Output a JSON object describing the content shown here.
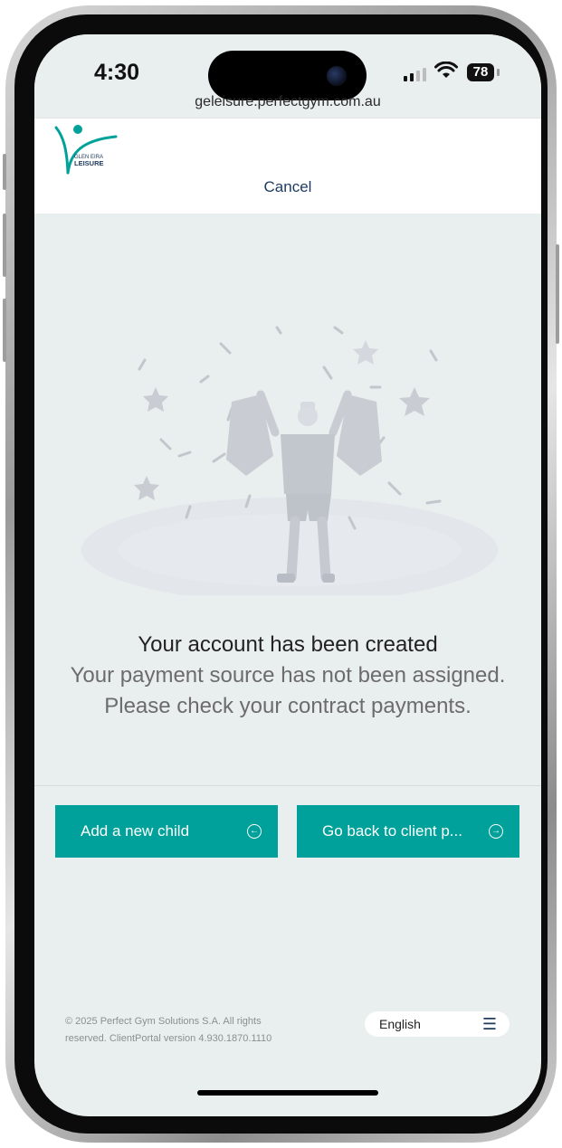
{
  "status_bar": {
    "time": "4:30",
    "battery": "78",
    "url": "geleisure.perfectgym.com.au"
  },
  "brand": {
    "logo_line1": "GLEN EIRA",
    "logo_line2": "LEISURE",
    "primary_color": "#00a19a",
    "navy_color": "#1c3a5e"
  },
  "header": {
    "cancel_label": "Cancel"
  },
  "message": {
    "title": "Your account has been created",
    "line2": "Your payment source has not been assigned.",
    "line3": "Please check your contract payments."
  },
  "actions": {
    "add_child_label": "Add a new child",
    "go_back_label": "Go back to client p..."
  },
  "footer": {
    "copyright_line1": "© 2025 Perfect Gym Solutions S.A. All rights",
    "copyright_line2": "reserved. ClientPortal version 4.930.1870.1110",
    "language": "English"
  },
  "icons": {
    "add_child": "circle-arrow-left-icon",
    "go_back": "circle-arrow-right-icon",
    "language_menu": "hamburger-menu-icon"
  }
}
